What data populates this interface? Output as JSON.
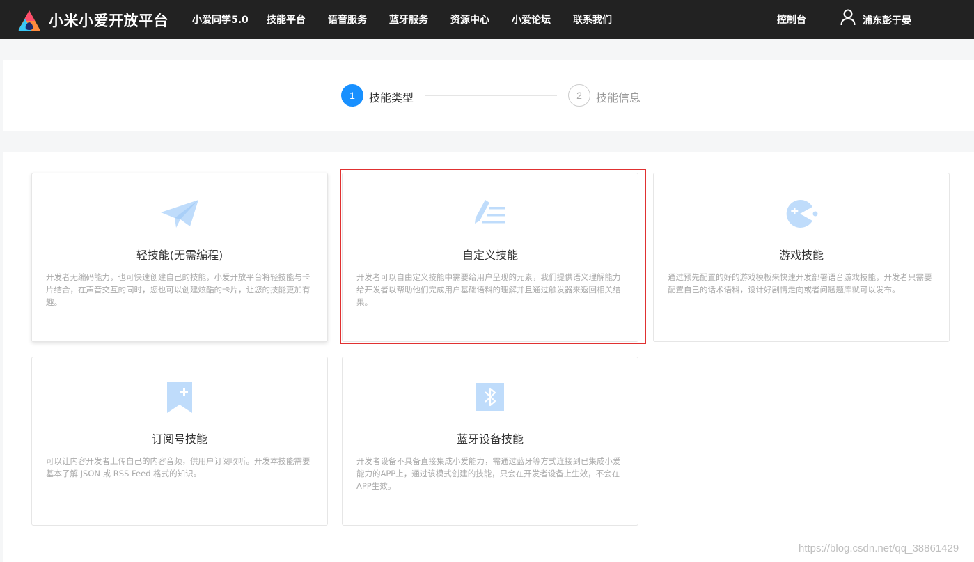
{
  "header": {
    "brand": "小米小爱开放平台",
    "nav": [
      {
        "label": "小爱同学5.0"
      },
      {
        "label": "技能平台"
      },
      {
        "label": "语音服务"
      },
      {
        "label": "蓝牙服务"
      },
      {
        "label": "资源中心"
      },
      {
        "label": "小爱论坛"
      },
      {
        "label": "联系我们"
      }
    ],
    "console": "控制台",
    "username": "浦东彭于晏"
  },
  "steps": [
    {
      "number": "1",
      "label": "技能类型",
      "state": "active"
    },
    {
      "number": "2",
      "label": "技能信息",
      "state": "inactive"
    }
  ],
  "cards": [
    {
      "title": "轻技能(无需编程)",
      "icon": "paper-plane-icon",
      "description": "开发者无编码能力，也可快速创建自己的技能，小爱开放平台将轻技能与卡片结合，在声音交互的同时，您也可以创建炫酷的卡片，让您的技能更加有趣。"
    },
    {
      "title": "自定义技能",
      "icon": "edit-list-icon",
      "description": "开发者可以自由定义技能中需要给用户呈现的元素，我们提供语义理解能力给开发者以帮助他们完成用户基础语料的理解并且通过触发器来返回相关结果。"
    },
    {
      "title": "游戏技能",
      "icon": "game-pacman-icon",
      "description": "通过预先配置的好的游戏模板来快速开发部署语音游戏技能，开发者只需要配置自己的话术语料，设计好剧情走向或者问题题库就可以发布。"
    },
    {
      "title": "订阅号技能",
      "icon": "bookmark-add-icon",
      "description": "可以让内容开发者上传自己的内容音频，供用户订阅收听。开发本技能需要基本了解 JSON 或 RSS Feed 格式的知识。"
    },
    {
      "title": "蓝牙设备技能",
      "icon": "bluetooth-icon",
      "description": "开发者设备不具备直接集成小爱能力，需通过蓝牙等方式连接到已集成小爱能力的APP上，通过该模式创建的技能，只会在开发者设备上生效，不会在APP生效。"
    }
  ],
  "watermark": "https://blog.csdn.net/qq_38861429",
  "colors": {
    "header_bg": "#222222",
    "accent": "#1890ff",
    "icon": "#bfdcfb",
    "highlight": "#e03131"
  }
}
